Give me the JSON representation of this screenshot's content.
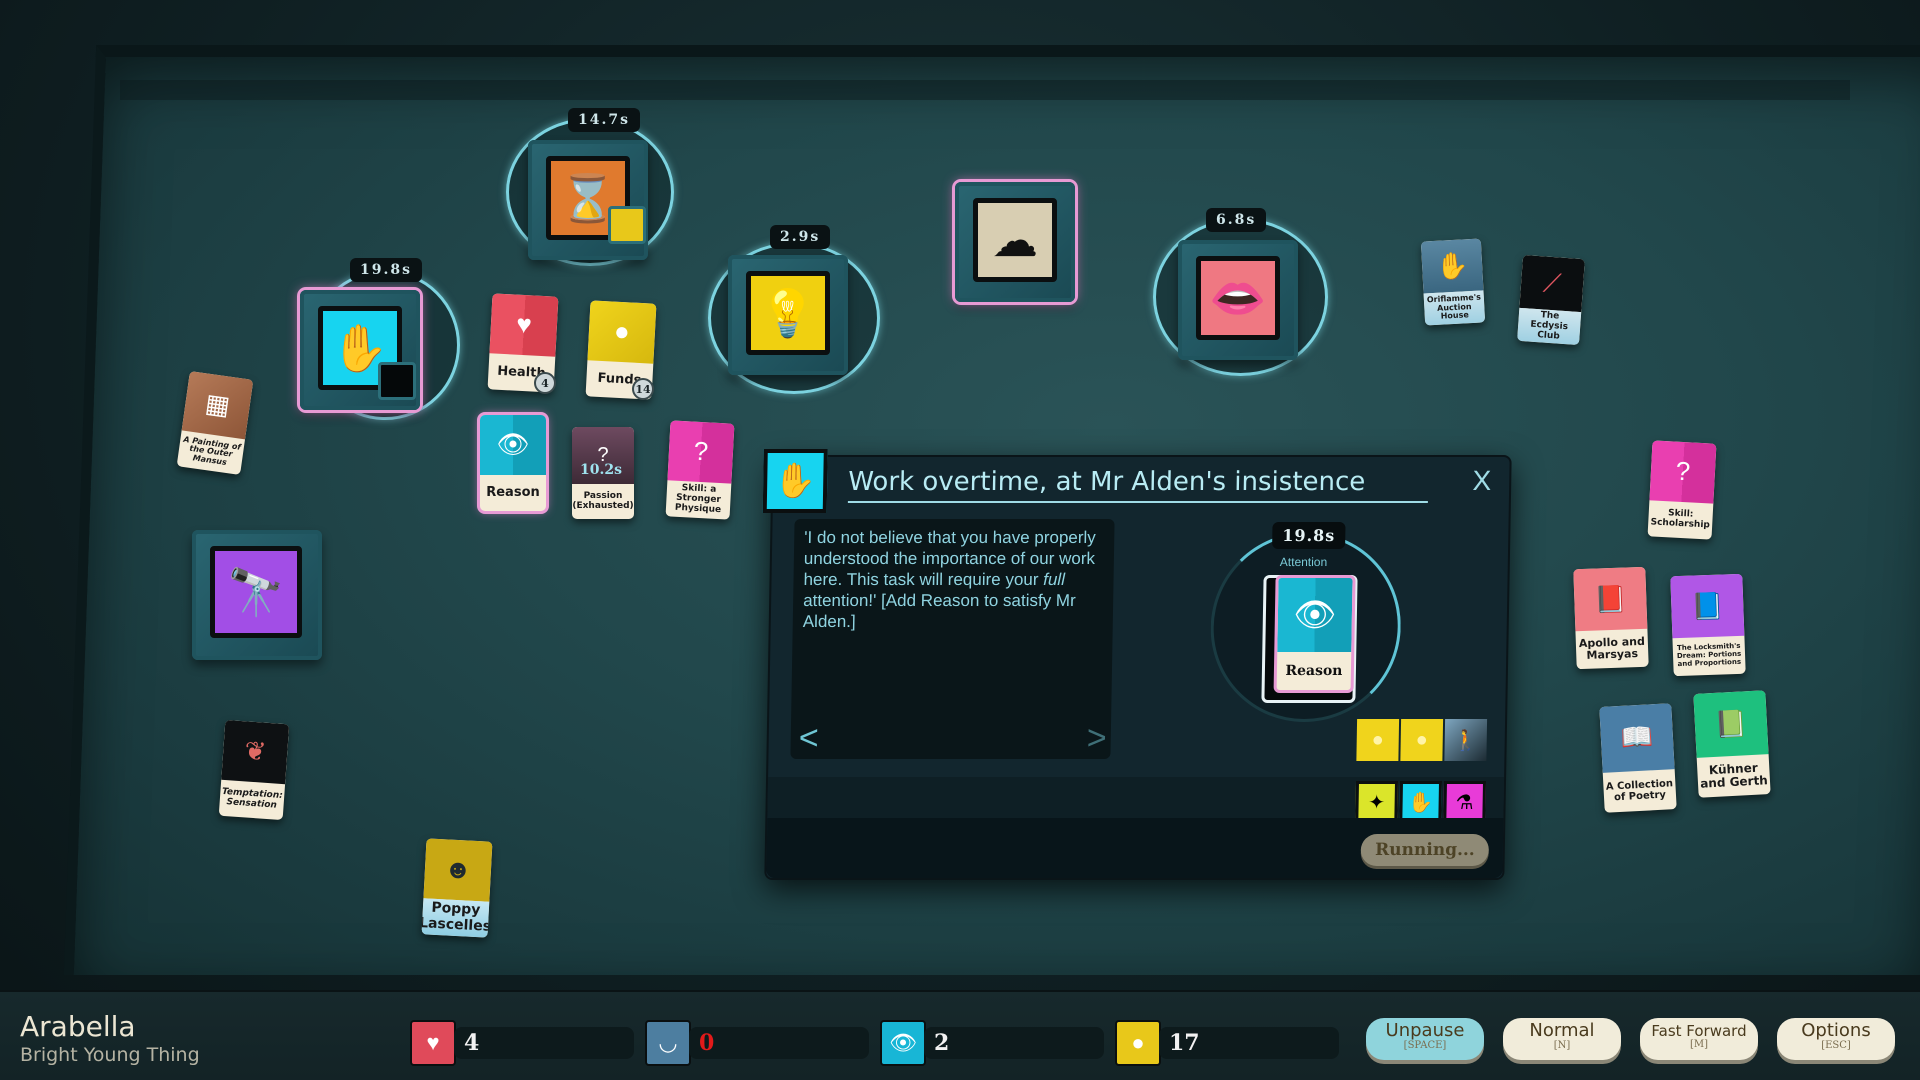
{
  "player": {
    "name": "Arabella",
    "title": "Bright Young Thing"
  },
  "stats": [
    {
      "id": "health",
      "icon": "heart-icon",
      "value": "4",
      "color": "#e04a5a",
      "value_color": "#f2f2f2"
    },
    {
      "id": "dread",
      "icon": "closed-eye-icon",
      "value": "0",
      "color": "#4d7ea0",
      "value_color": "#e21a1a"
    },
    {
      "id": "reason",
      "icon": "eye-icon",
      "value": "2",
      "color": "#18b6d6",
      "value_color": "#f2f2f2"
    },
    {
      "id": "funds",
      "icon": "coin-icon",
      "value": "17",
      "color": "#e8c81a",
      "value_color": "#f2f2f2"
    }
  ],
  "controls": [
    {
      "label": "Unpause",
      "key": "[SPACE]",
      "active": true
    },
    {
      "label": "Normal",
      "key": "[N]",
      "active": false
    },
    {
      "label": "Fast Forward",
      "key": "[M]",
      "active": false
    },
    {
      "label": "Options",
      "key": "[ESC]",
      "active": false
    }
  ],
  "verbs": [
    {
      "id": "work",
      "icon": "hand-eye-icon",
      "timer": "19.8s",
      "color": "#17d4f0",
      "selected": true
    },
    {
      "id": "time",
      "icon": "hourglass-icon",
      "timer": "14.7s",
      "color": "#e07a2e",
      "selected": false
    },
    {
      "id": "study",
      "icon": "lightbulb-icon",
      "timer": "2.9s",
      "color": "#f0d010",
      "selected": false
    },
    {
      "id": "dream",
      "icon": "cloud-star-icon",
      "timer": "",
      "color": "#d8ceb2",
      "selected": true
    },
    {
      "id": "talk",
      "icon": "lips-icon",
      "timer": "6.8s",
      "color": "#ef7882",
      "selected": false
    },
    {
      "id": "explore",
      "icon": "telescope-icon",
      "timer": "",
      "color": "#a24ee6",
      "selected": false
    }
  ],
  "cards": [
    {
      "id": "health",
      "label": "Health",
      "badge": "4"
    },
    {
      "id": "funds",
      "label": "Funds",
      "badge": "14"
    },
    {
      "id": "reason",
      "label": "Reason"
    },
    {
      "id": "passion",
      "label": "Passion (Exhausted)",
      "timer": "10.2s"
    },
    {
      "id": "skill-physique",
      "label": "Skill: a Stronger Physique"
    },
    {
      "id": "painting",
      "label": "A Painting of the Outer Mansus"
    },
    {
      "id": "temptation",
      "label": "Temptation: Sensation"
    },
    {
      "id": "poppy",
      "label": "Poppy Lascelles"
    },
    {
      "id": "oriflamme",
      "label": "Oriflamme's Auction House"
    },
    {
      "id": "ecdysis",
      "label": "The Ecdysis Club"
    },
    {
      "id": "scholarship",
      "label": "Skill: Scholarship"
    },
    {
      "id": "apollo",
      "label": "Apollo and Marsyas"
    },
    {
      "id": "locksmith",
      "label": "The Locksmith's Dream: Portions and Proportions"
    },
    {
      "id": "poetry",
      "label": "A Collection of Poetry"
    },
    {
      "id": "kuhner",
      "label": "Kühner and Gerth"
    }
  ],
  "dialog": {
    "title": "Work overtime, at Mr Alden's insistence",
    "close_label": "X",
    "text_before": "'I do not believe that you have properly understood the importance of our work here. This task will require your ",
    "text_emph": "full",
    "text_after": " attention!' [Add Reason to satisfy Mr Alden.]",
    "prev_label": "<",
    "next_label": ">",
    "slot_timer": "19.8s",
    "slot_label": "Attention",
    "slot_card_label": "Reason",
    "running_label": "Running..."
  }
}
